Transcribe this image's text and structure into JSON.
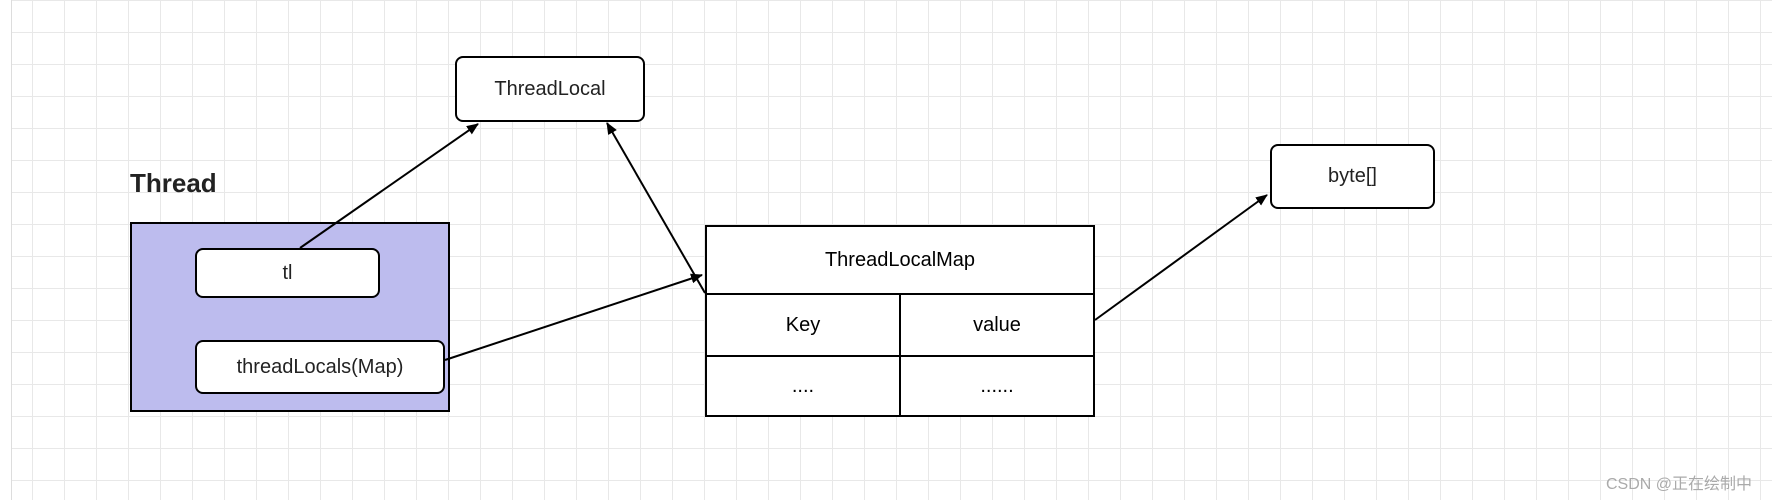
{
  "title": "Thread",
  "thread_box": {
    "tl_label": "tl",
    "threadlocals_label": "threadLocals(Map)"
  },
  "threadlocal_label": "ThreadLocal",
  "byte_label": "byte[]",
  "map": {
    "header": "ThreadLocalMap",
    "rows": [
      {
        "key": "Key",
        "value": "value"
      },
      {
        "key": "....",
        "value": "......"
      }
    ]
  },
  "watermark": "CSDN @正在绘制中"
}
